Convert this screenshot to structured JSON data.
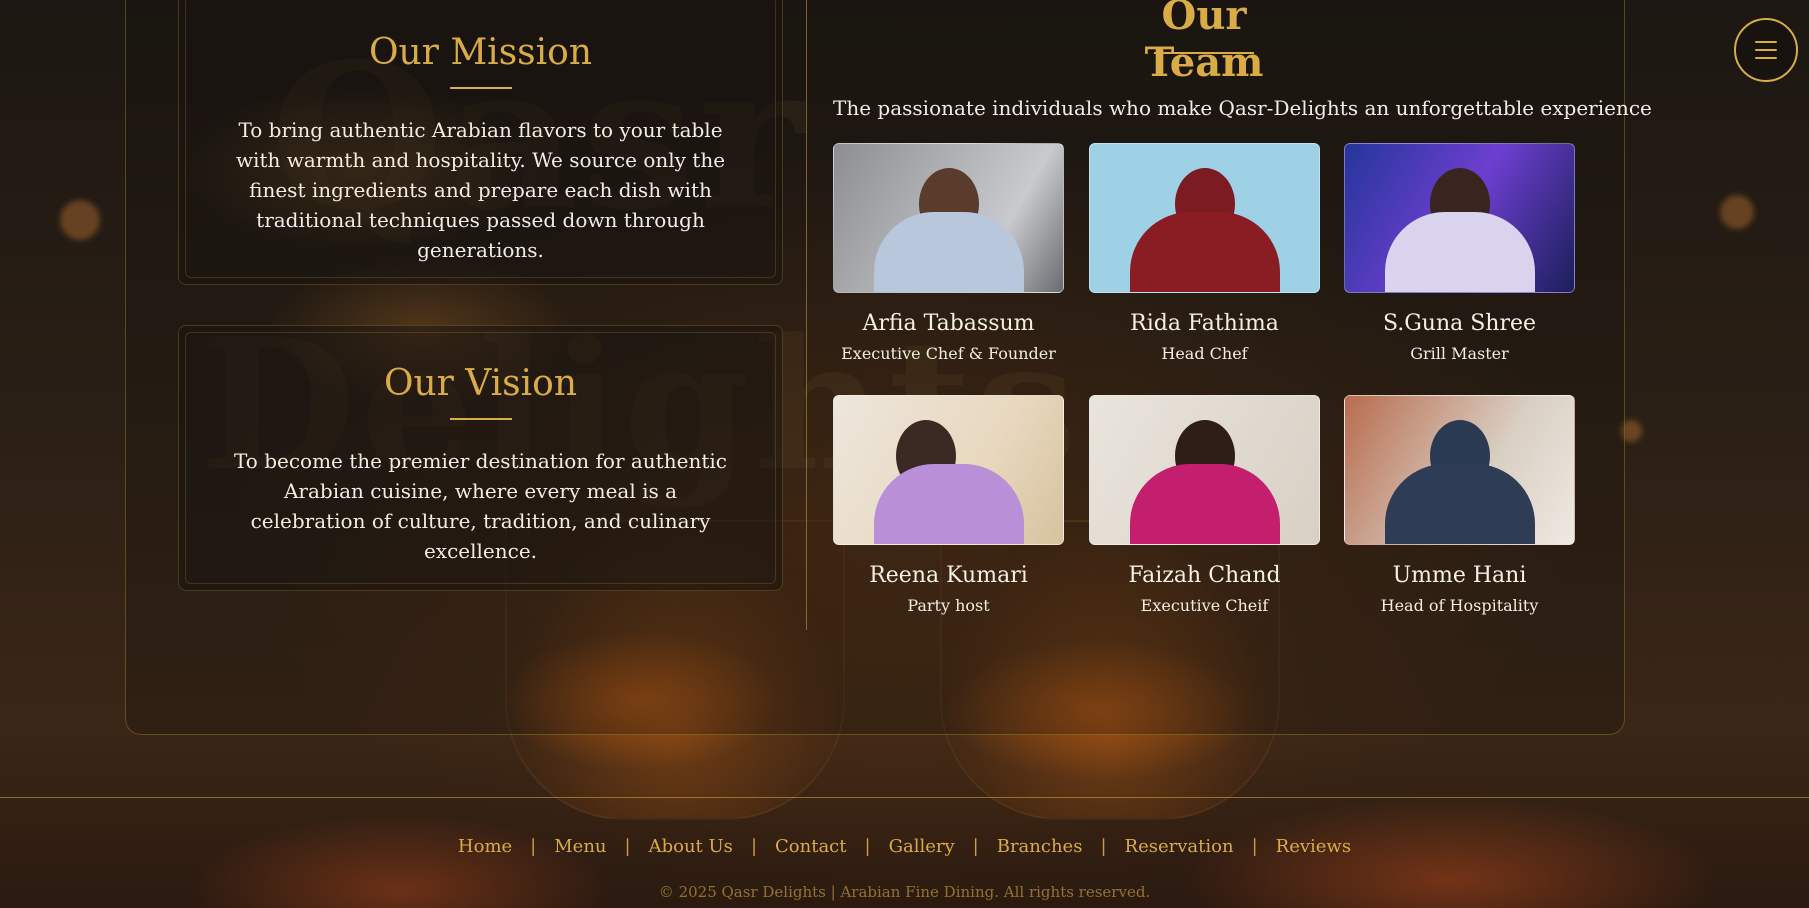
{
  "mission": {
    "title": "Our Mission",
    "text": "To bring authentic Arabian flavors to your table with warmth and hospitality. We source only the finest ingredients and prepare each dish with traditional techniques passed down through generations."
  },
  "vision": {
    "title": "Our Vision",
    "text": "To become the premier destination for authentic Arabian cuisine, where every meal is a celebration of culture, tradition, and culinary excellence."
  },
  "team": {
    "title": "Our Team",
    "subtitle": "The passionate individuals who make Qasr-Delights an unforgettable experience",
    "members": [
      {
        "name": "Arfia Tabassum",
        "role": "Executive Chef & Founder"
      },
      {
        "name": "Rida Fathima",
        "role": "Head Chef"
      },
      {
        "name": "S.Guna Shree",
        "role": "Grill Master"
      },
      {
        "name": "Reena Kumari",
        "role": "Party host"
      },
      {
        "name": "Faizah Chand",
        "role": "Executive Cheif"
      },
      {
        "name": "Umme Hani",
        "role": "Head of Hospitality"
      }
    ]
  },
  "background": {
    "word_1": "Qasr",
    "word_2": "Delights"
  },
  "footer": {
    "nav": [
      "Home",
      "Menu",
      "About Us",
      "Contact",
      "Gallery",
      "Branches",
      "Reservation",
      "Reviews"
    ],
    "separator": "|",
    "copyright": "© 2025 Qasr Delights | Arabian Fine Dining. All rights reserved."
  },
  "colors": {
    "accent": "#d9ac45",
    "text": "#f3ece1"
  },
  "icons": {
    "menu": "hamburger-menu-icon"
  }
}
